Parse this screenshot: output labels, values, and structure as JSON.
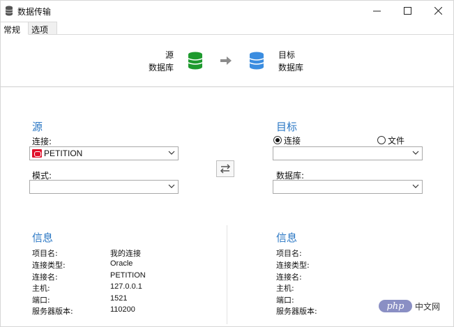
{
  "window": {
    "title": "数据传输",
    "icon": "database-stack-icon"
  },
  "tabs": [
    {
      "label": "常规",
      "active": true
    },
    {
      "label": "选项",
      "active": false
    }
  ],
  "header": {
    "source_line1": "源",
    "source_line2": "数据库",
    "target_line1": "目标",
    "target_line2": "数据库",
    "source_color": "#1e9a2e",
    "target_color": "#3b8de0"
  },
  "source": {
    "title": "源",
    "connection_label": "连接:",
    "connection_value": "PETITION",
    "schema_label": "模式:",
    "schema_value": ""
  },
  "target": {
    "title": "目标",
    "radio_connection": "连接",
    "radio_file": "文件",
    "selected": "connection",
    "connection_value": "",
    "database_label": "数据库:",
    "database_value": ""
  },
  "source_info": {
    "title": "信息",
    "rows": [
      {
        "key": "项目名:",
        "value": "我的连接"
      },
      {
        "key": "连接类型:",
        "value": "Oracle"
      },
      {
        "key": "连接名:",
        "value": "PETITION"
      },
      {
        "key": "主机:",
        "value": "127.0.0.1"
      },
      {
        "key": "端口:",
        "value": "1521"
      },
      {
        "key": "服务器版本:",
        "value": "110200"
      }
    ]
  },
  "target_info": {
    "title": "信息",
    "rows": [
      {
        "key": "项目名:"
      },
      {
        "key": "连接类型:"
      },
      {
        "key": "连接名:"
      },
      {
        "key": "主机:"
      },
      {
        "key": "端口:"
      },
      {
        "key": "服务器版本:"
      }
    ]
  },
  "watermark": {
    "badge": "php",
    "text": "中文网"
  },
  "colors": {
    "accent": "#2a77c4",
    "oracle_badge": "#e0102a"
  }
}
